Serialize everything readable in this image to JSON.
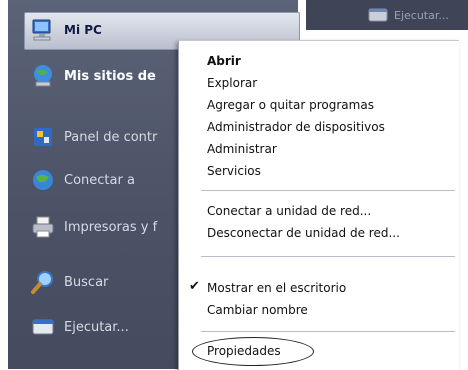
{
  "start_menu": {
    "items": [
      {
        "label": "Mi PC",
        "icon": "my-computer-icon"
      },
      {
        "label": "Mis sitios de",
        "icon": "network-places-icon"
      },
      {
        "label": "Panel de contr",
        "icon": "control-panel-icon"
      },
      {
        "label": "Conectar a",
        "icon": "connect-to-icon"
      },
      {
        "label": "Impresoras y f",
        "icon": "printers-icon"
      },
      {
        "label": "Buscar",
        "icon": "search-icon"
      },
      {
        "label": "Ejecutar...",
        "icon": "run-icon"
      }
    ],
    "top_right_label": "Ejecutar..."
  },
  "context_menu": {
    "items": [
      {
        "label": "Abrir",
        "bold": true
      },
      {
        "label": "Explorar"
      },
      {
        "label": "Agregar o quitar programas"
      },
      {
        "label": "Administrador de dispositivos"
      },
      {
        "label": "Administrar"
      },
      {
        "label": "Servicios"
      },
      {
        "label": "Conectar a unidad de red..."
      },
      {
        "label": "Desconectar de unidad de red..."
      },
      {
        "label": "Mostrar en el escritorio",
        "checked": true
      },
      {
        "label": "Cambiar nombre"
      },
      {
        "label": "Propiedades",
        "highlighted": true
      }
    ],
    "check_glyph": "✔"
  }
}
